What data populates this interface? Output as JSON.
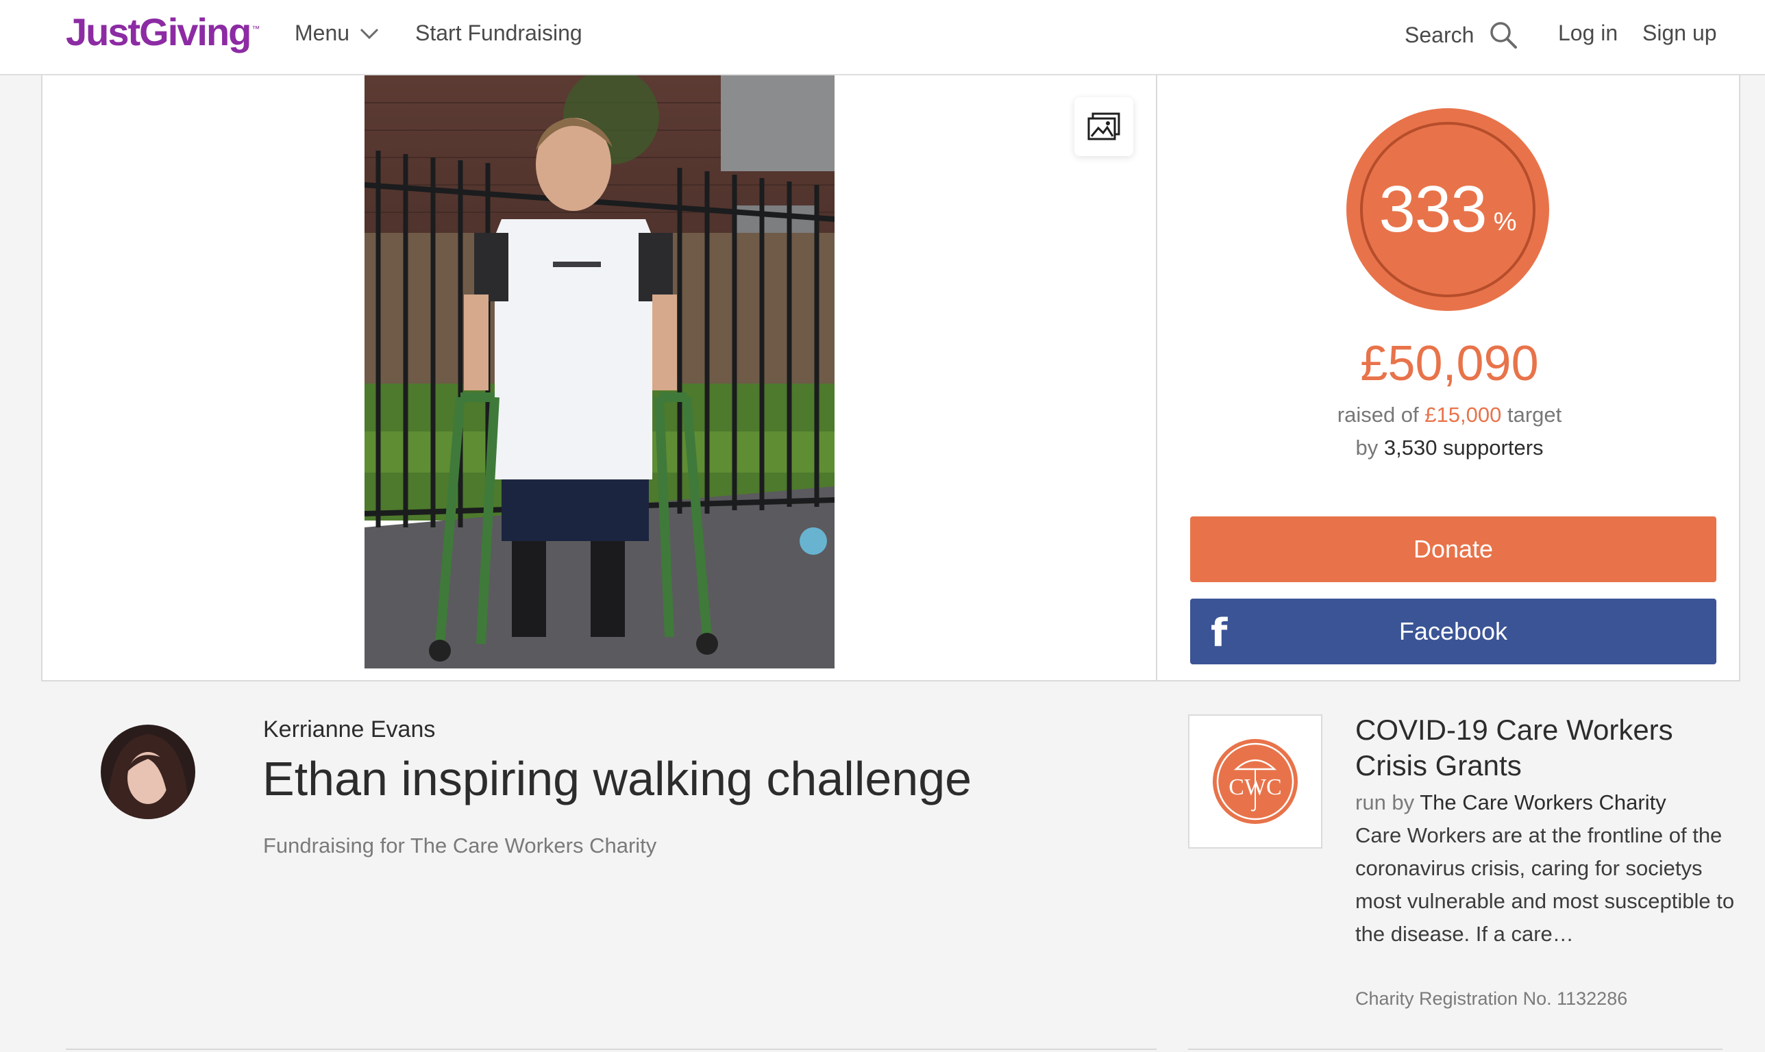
{
  "header": {
    "logo": "JustGiving",
    "logo_tm": "™",
    "menu_label": "Menu",
    "start_label": "Start Fundraising",
    "search_label": "Search",
    "login_label": "Log in",
    "signup_label": "Sign up"
  },
  "progress": {
    "percent": "333",
    "percent_symbol": "%",
    "raised": "£50,090",
    "raised_prefix": "raised of",
    "target": "£15,000",
    "target_suffix": "target",
    "by_prefix": "by",
    "supporters": "3,530 supporters"
  },
  "actions": {
    "donate_label": "Donate",
    "facebook_label": "Facebook",
    "facebook_glyph": "f"
  },
  "page": {
    "owner": "Kerrianne Evans",
    "title": "Ethan inspiring walking challenge",
    "fundraising_for": "Fundraising for The Care Workers Charity"
  },
  "charity": {
    "logo_text": "CWC",
    "campaign": "COVID-19 Care Workers Crisis Grants",
    "run_by_prefix": "run by",
    "name": "The Care Workers Charity",
    "description": "Care Workers are at the frontline of the coronavirus crisis, caring for societys most vulnerable and most susceptible to the disease. If a care…",
    "registration": "Charity Registration No. 1132286"
  },
  "icons": {
    "menu": "chevron-down-icon",
    "search": "search-icon",
    "gallery": "image-gallery-icon",
    "facebook": "facebook-icon"
  },
  "colors": {
    "brand_purple": "#8c2ba3",
    "accent_orange": "#e8734a",
    "facebook_blue": "#3b5496"
  }
}
